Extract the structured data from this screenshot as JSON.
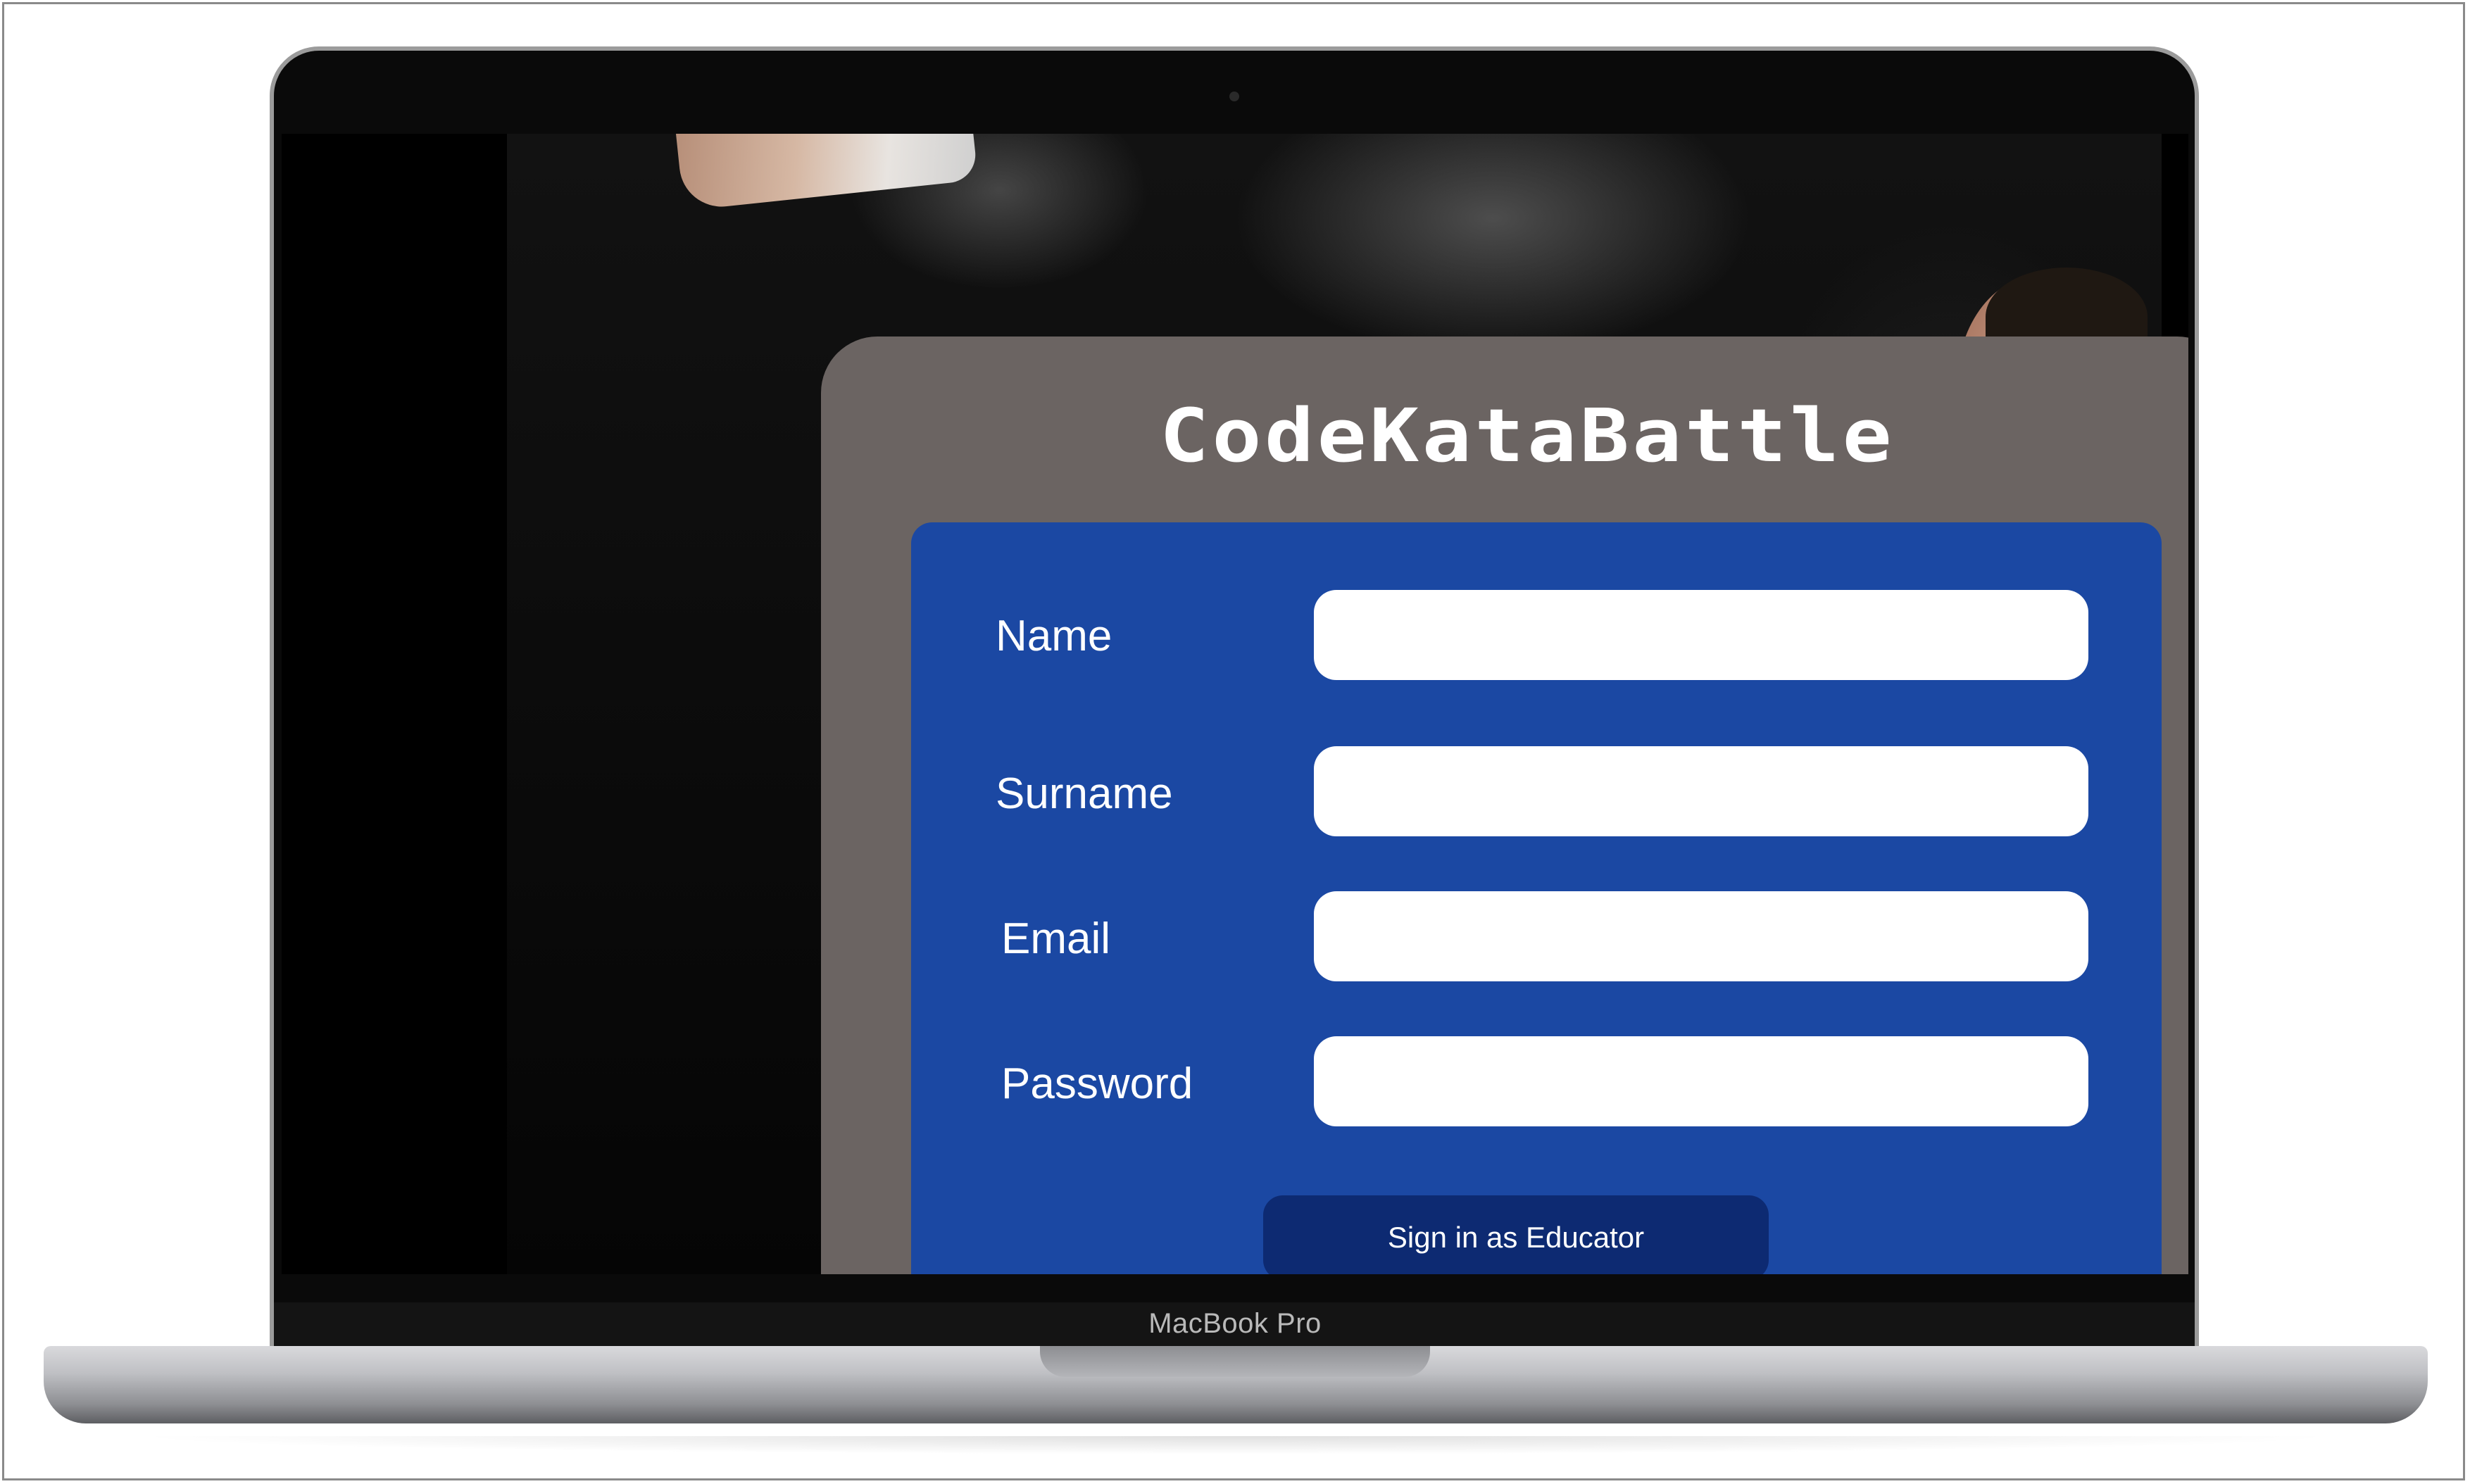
{
  "device": {
    "brand_label": "MacBook Pro"
  },
  "app": {
    "title": "CodeKataBattle"
  },
  "form": {
    "fields": [
      {
        "label": "Name",
        "value": "",
        "placeholder": ""
      },
      {
        "label": "Surname",
        "value": "",
        "placeholder": ""
      },
      {
        "label": "Email",
        "value": "",
        "placeholder": ""
      },
      {
        "label": "Password",
        "value": "",
        "placeholder": ""
      }
    ],
    "submit_label": "Sign in as Educator"
  },
  "colors": {
    "modal_background": "#6b6462",
    "form_panel": "#1b48a3",
    "button": "#0d2a72",
    "input_background": "#ffffff",
    "text": "#ffffff"
  }
}
